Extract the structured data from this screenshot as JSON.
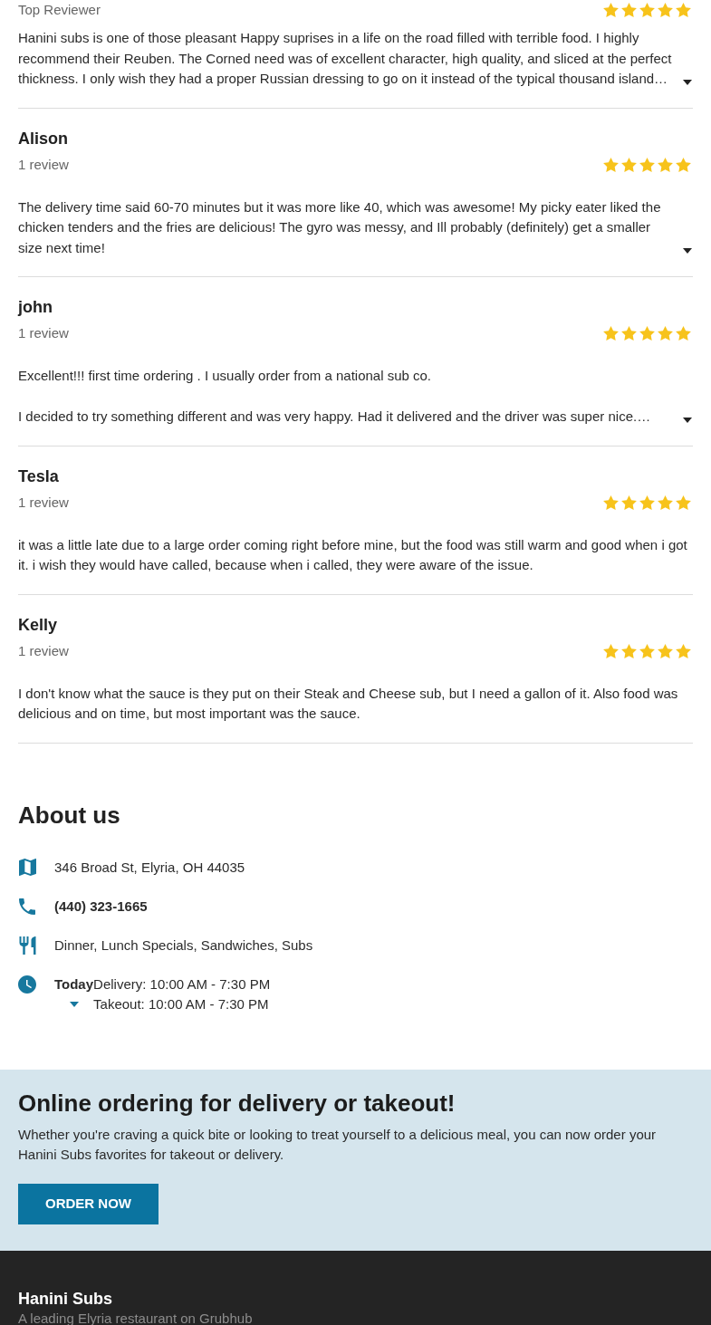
{
  "reviews": [
    {
      "subtitle": "Top Reviewer",
      "stars": 5,
      "paragraphs": [
        "Hanini subs is one of those pleasant Happy suprises in a life on the road filled with terrible food. I highly recommend their Reuben. The Corned need was of excellent character, high quality, and sliced at the perfect thickness. I only wish they had a proper Russian dressing to go on it instead of the typical thousand island…"
      ],
      "expandable": true
    },
    {
      "name": "Alison",
      "subtitle": "1 review",
      "stars": 5,
      "paragraphs": [
        "The delivery time said 60-70 minutes but it was more like 40, which was awesome! My picky eater liked the chicken tenders and the fries are delicious! The gyro was messy, and Ill probably (definitely) get a smaller size next time!"
      ],
      "expandable": true
    },
    {
      "name": "john",
      "subtitle": "1 review",
      "stars": 5,
      "paragraphs": [
        "Excellent!!! first time ordering . I usually order from a national sub co.",
        "I decided to try something different and was very happy. Had it delivered and the driver was super nice.…"
      ],
      "expandable": true
    },
    {
      "name": "Tesla",
      "subtitle": "1 review",
      "stars": 5,
      "paragraphs": [
        "it was a little late due to a large order coming right before mine, but the food was still warm and good when i got it. i wish they would have called, because when i called, they were aware of the issue."
      ],
      "expandable": false
    },
    {
      "name": "Kelly",
      "subtitle": "1 review",
      "stars": 5,
      "paragraphs": [
        "I don't know what the sauce is they put on their Steak and Cheese sub, but I need a gallon of it. Also food was delicious and on time, but most important was the sauce."
      ],
      "expandable": false
    }
  ],
  "about": {
    "title": "About us",
    "address": "346 Broad St, Elyria, OH 44035",
    "phone": "(440) 323-1665",
    "categories": "Dinner, Lunch Specials, Sandwiches, Subs",
    "hours": {
      "day": "Today",
      "lines": [
        "Delivery: 10:00 AM - 7:30 PM",
        "Takeout: 10:00 AM - 7:30 PM"
      ]
    }
  },
  "promo": {
    "title": "Online ordering for delivery or takeout!",
    "text": "Whether you're craving a quick bite or looking to treat yourself to a delicious meal, you can now order your Hanini Subs favorites for takeout or delivery.",
    "button": "ORDER NOW"
  },
  "footer": {
    "title": "Hanini Subs",
    "subtitle": "A leading Elyria restaurant on Grubhub"
  }
}
